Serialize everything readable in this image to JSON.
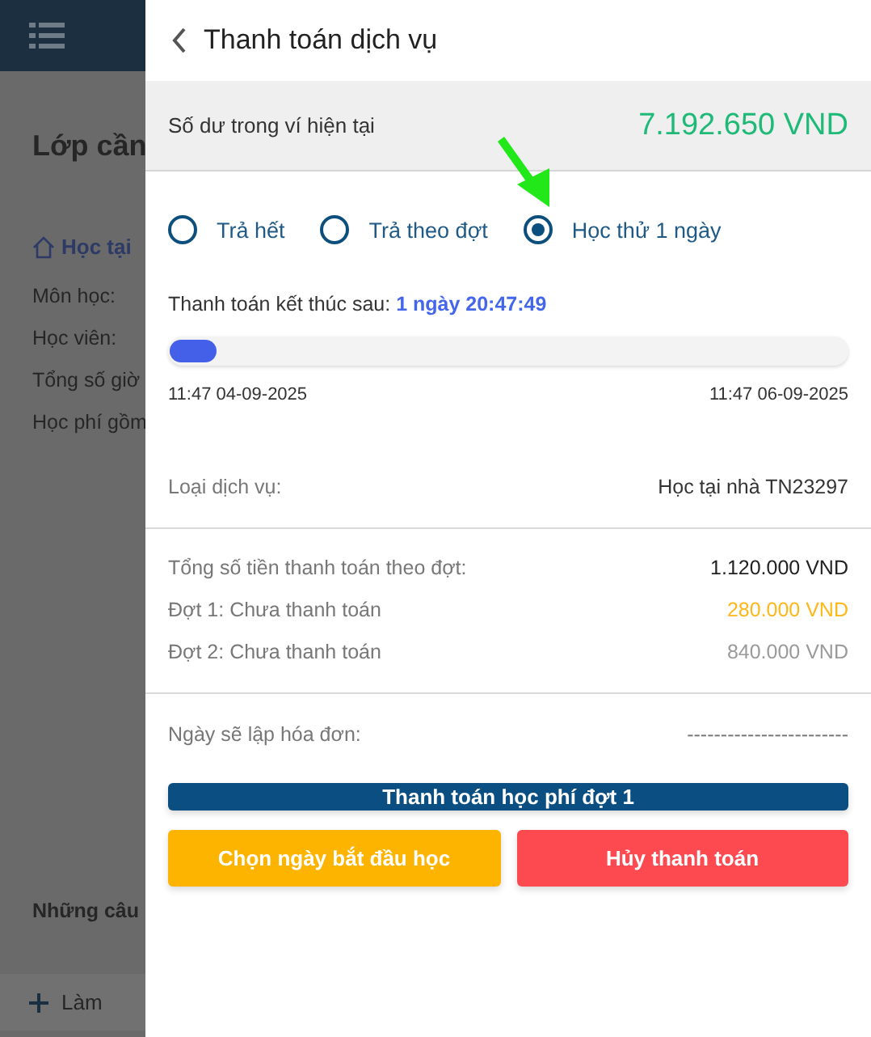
{
  "background_page": {
    "title": "Lớp cần",
    "section": "Học tại",
    "fields": [
      "Môn học:",
      "Học viên:",
      "Tổng số giờ",
      "Học phí gồm"
    ],
    "faq_title": "Những câu",
    "add_button": "Làm"
  },
  "panel": {
    "title": "Thanh toán dịch vụ",
    "balance": {
      "label": "Số dư trong ví hiện tại",
      "value": "7.192.650 VND"
    },
    "payment_options": [
      {
        "label": "Trả hết",
        "selected": false
      },
      {
        "label": "Trả theo đợt",
        "selected": false
      },
      {
        "label": "Học thử 1 ngày",
        "selected": true
      }
    ],
    "countdown": {
      "label": "Thanh toán kết thúc sau:",
      "value": "1 ngày 20:47:49"
    },
    "progress": {
      "level": 0.07,
      "start": "11:47 04-09-2025",
      "end": "11:47 06-09-2025"
    },
    "service": {
      "label": "Loại dịch vụ:",
      "value": "Học tại nhà TN23297"
    },
    "installments": [
      {
        "label": "Tổng số tiền thanh toán theo đợt:",
        "value": "1.120.000 VND",
        "kind": "total"
      },
      {
        "label": "Đợt 1: Chưa thanh toán",
        "value": "280.000 VND",
        "kind": "due"
      },
      {
        "label": "Đợt 2: Chưa thanh toán",
        "value": "840.000 VND",
        "kind": "pending"
      }
    ],
    "invoice": {
      "label": "Ngày sẽ lập hóa đơn:",
      "value": "------------------------"
    },
    "buttons": [
      {
        "label": "Thanh toán học phí đợt 1",
        "kind": "primary"
      },
      {
        "label": "Chọn ngày bắt đầu học",
        "kind": "warning"
      },
      {
        "label": "Hủy thanh toán",
        "kind": "danger"
      }
    ]
  }
}
